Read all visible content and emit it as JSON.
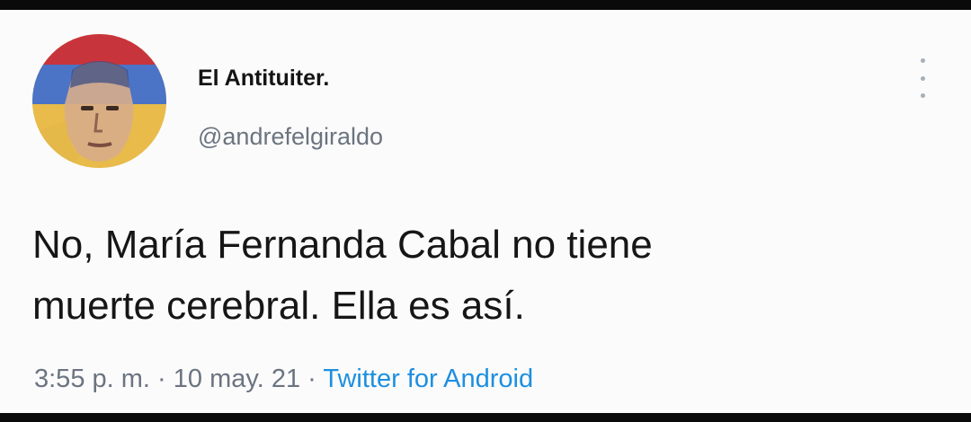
{
  "tweet": {
    "display_name": "El Antituiter.",
    "handle": "@andrefelgiraldo",
    "text_lines": [
      "No, María Fernanda Cabal no tiene",
      "muerte cerebral. Ella es así."
    ],
    "time": "3:55 p. m.",
    "separator": "·",
    "date": "10 may. 21",
    "source": "Twitter for Android"
  },
  "icons": {
    "more": "more-vertical-icon"
  },
  "colors": {
    "name": "#141414",
    "secondary": "#6b7480",
    "link": "#1d8fe0",
    "background": "#fbfbfb",
    "flag_yellow": "#e8b63a",
    "flag_blue": "#4a72c6",
    "flag_red": "#c8343c"
  }
}
